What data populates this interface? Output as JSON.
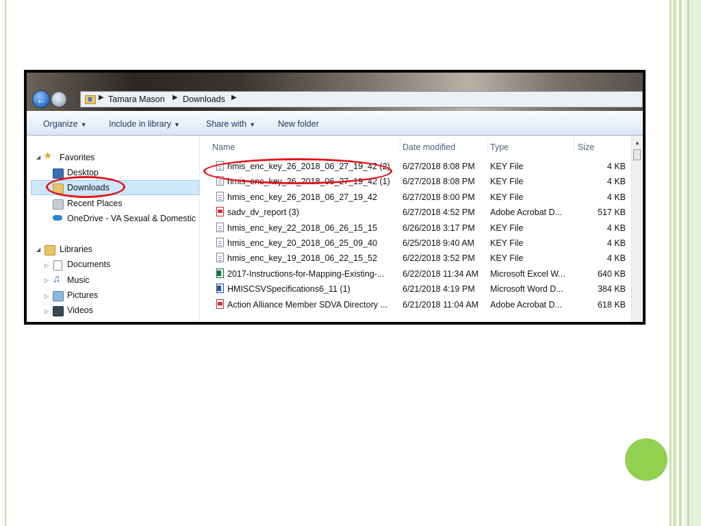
{
  "breadcrumb": [
    "Tamara Mason",
    "Downloads"
  ],
  "toolbar": {
    "organize": "Organize",
    "include_in_library": "Include in library",
    "share_with": "Share with",
    "new_folder": "New folder"
  },
  "nav": {
    "favorites": "Favorites",
    "desktop": "Desktop",
    "downloads": "Downloads",
    "recent_places": "Recent Places",
    "onedrive": "OneDrive - VA Sexual & Domestic",
    "libraries": "Libraries",
    "documents": "Documents",
    "music": "Music",
    "pictures": "Pictures",
    "videos": "Videos"
  },
  "columns": [
    "Name",
    "Date modified",
    "Type",
    "Size"
  ],
  "files": [
    {
      "name": "hmis_enc_key_26_2018_06_27_19_42 (2)",
      "date": "6/27/2018 8:08 PM",
      "type": "KEY File",
      "size": "4 KB",
      "icon": "key"
    },
    {
      "name": "hmis_enc_key_26_2018_06_27_19_42 (1)",
      "date": "6/27/2018 8:08 PM",
      "type": "KEY File",
      "size": "4 KB",
      "icon": "key"
    },
    {
      "name": "hmis_enc_key_26_2018_06_27_19_42",
      "date": "6/27/2018 8:00 PM",
      "type": "KEY File",
      "size": "4 KB",
      "icon": "key"
    },
    {
      "name": "sadv_dv_report (3)",
      "date": "6/27/2018 4:52 PM",
      "type": "Adobe Acrobat D...",
      "size": "517 KB",
      "icon": "pdf"
    },
    {
      "name": "hmis_enc_key_22_2018_06_26_15_15",
      "date": "6/26/2018 3:17 PM",
      "type": "KEY File",
      "size": "4 KB",
      "icon": "key"
    },
    {
      "name": "hmis_enc_key_20_2018_06_25_09_40",
      "date": "6/25/2018 9:40 AM",
      "type": "KEY File",
      "size": "4 KB",
      "icon": "key"
    },
    {
      "name": "hmis_enc_key_19_2018_06_22_15_52",
      "date": "6/22/2018 3:52 PM",
      "type": "KEY File",
      "size": "4 KB",
      "icon": "key"
    },
    {
      "name": "2017-Instructions-for-Mapping-Existing-...",
      "date": "6/22/2018 11:34 AM",
      "type": "Microsoft Excel W...",
      "size": "640 KB",
      "icon": "xls"
    },
    {
      "name": "HMISCSVSpecifications6_11 (1)",
      "date": "6/21/2018 4:19 PM",
      "type": "Microsoft Word D...",
      "size": "384 KB",
      "icon": "doc"
    },
    {
      "name": "Action Alliance Member SDVA Directory ...",
      "date": "6/21/2018 11:04 AM",
      "type": "Adobe Acrobat D...",
      "size": "618 KB",
      "icon": "pdf"
    }
  ],
  "colors": {
    "slide_accent": "#92d050",
    "frame_line": "#c7dfb0",
    "callout": "#e3141b",
    "selection": "#cde8fb"
  }
}
